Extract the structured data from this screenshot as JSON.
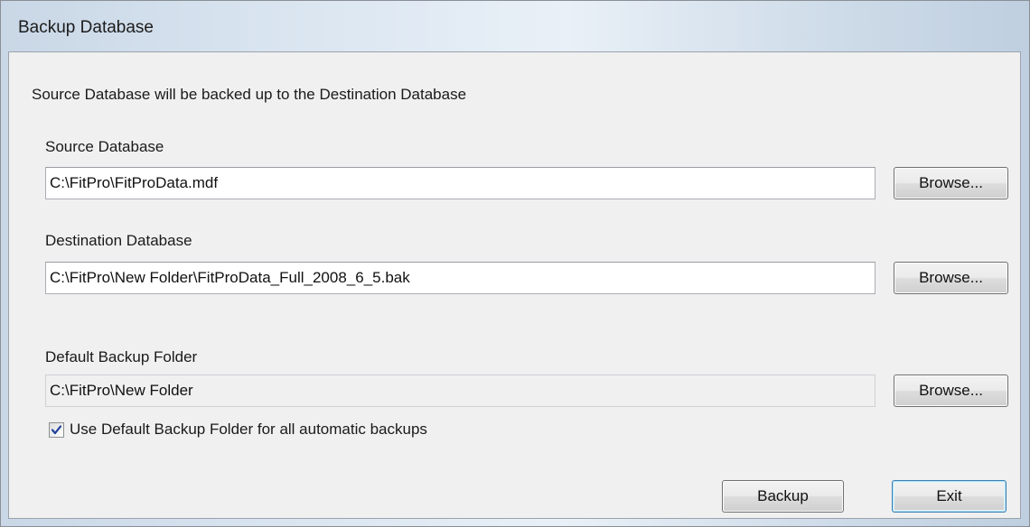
{
  "window": {
    "title": "Backup Database"
  },
  "intro_text": "Source Database will be backed up to the Destination Database",
  "source": {
    "label": "Source Database",
    "value": "C:\\FitPro\\FitProData.mdf",
    "browse_label": "Browse..."
  },
  "destination": {
    "label": "Destination Database",
    "value": "C:\\FitPro\\New Folder\\FitProData_Full_2008_6_5.bak",
    "browse_label": "Browse..."
  },
  "default_folder": {
    "label": "Default Backup Folder",
    "value": "C:\\FitPro\\New Folder",
    "browse_label": "Browse...",
    "readonly": true
  },
  "use_default_checkbox": {
    "label": "Use Default Backup Folder for all automatic backups",
    "checked": true
  },
  "actions": {
    "backup_label": "Backup",
    "exit_label": "Exit"
  },
  "colors": {
    "client_background": "#f0f0f0",
    "checkmark": "#1f3f9a",
    "default_button_border": "#3c7fb1"
  }
}
